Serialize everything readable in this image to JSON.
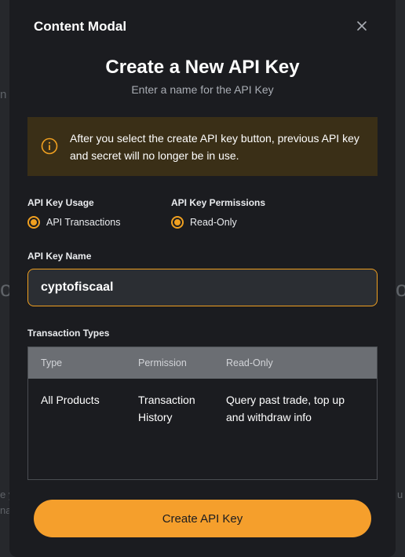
{
  "backdrop": {
    "frag_left_top": "n",
    "frag_left_mid": "o",
    "frag_right_mid": "o",
    "frag_left_bottom_1": "e y",
    "frag_left_bottom_2": "na",
    "frag_right_bottom": "u"
  },
  "modal": {
    "header_title": "Content Modal",
    "title": "Create a New API Key",
    "subtitle": "Enter a name for the API Key",
    "warning_text": "After you select the create API key button, previous API key and secret will no longer be in use.",
    "usage": {
      "label": "API Key Usage",
      "selected": "API Transactions"
    },
    "permissions": {
      "label": "API Key Permissions",
      "selected": "Read-Only"
    },
    "name_field": {
      "label": "API Key Name",
      "value": "cyptofiscaal"
    },
    "transactions": {
      "label": "Transaction Types",
      "headers": [
        "Type",
        "Permission",
        "Read-Only"
      ],
      "rows": [
        [
          "All Products",
          "Transaction History",
          "Query past trade, top up and withdraw info"
        ]
      ]
    },
    "create_button": "Create API Key"
  },
  "colors": {
    "accent": "#f59f2c",
    "warning_bg": "#3a2f17",
    "modal_bg": "#1b1c20"
  },
  "icons": {
    "close": "close-icon",
    "warning": "info-icon"
  }
}
